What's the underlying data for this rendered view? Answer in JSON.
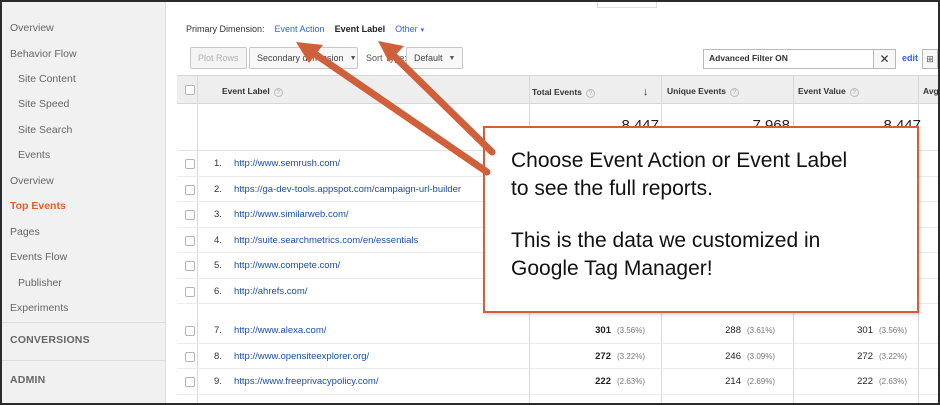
{
  "sidebar": {
    "items": [
      {
        "label": "Overview"
      },
      {
        "label": "Behavior Flow"
      },
      {
        "label": "Site Content"
      },
      {
        "label": "Site Speed"
      },
      {
        "label": "Site Search"
      },
      {
        "label": "Events"
      },
      {
        "label": "Overview"
      },
      {
        "label": "Top Events"
      },
      {
        "label": "Pages"
      },
      {
        "label": "Events Flow"
      },
      {
        "label": "Publisher"
      },
      {
        "label": "Experiments"
      }
    ],
    "sections": {
      "conversions": "CONVERSIONS",
      "admin": "ADMIN"
    }
  },
  "dimensions": {
    "label": "Primary Dimension:",
    "event_action": "Event Action",
    "event_label": "Event Label",
    "other": "Other"
  },
  "toolbar": {
    "plot_rows": "Plot Rows",
    "secondary_dimension": "Secondary dimension",
    "sort_type_label": "Sort Type:",
    "sort_type_value": "Default",
    "filter_value": "Advanced Filter ON",
    "edit": "edit"
  },
  "table": {
    "headers": {
      "event_label": "Event Label",
      "total_events": "Total Events",
      "unique_events": "Unique Events",
      "event_value": "Event Value",
      "avg": "Avg"
    },
    "totals": {
      "total_events": "8,447",
      "unique_events": "7,968",
      "event_value": "8,447"
    },
    "rows": [
      {
        "num": "1.",
        "label": "http://www.semrush.com/"
      },
      {
        "num": "2.",
        "label": "https://ga-dev-tools.appspot.com/campaign-url-builder"
      },
      {
        "num": "3.",
        "label": "http://www.similarweb.com/"
      },
      {
        "num": "4.",
        "label": "http://suite.searchmetrics.com/en/essentials"
      },
      {
        "num": "5.",
        "label": "http://www.compete.com/"
      },
      {
        "num": "6.",
        "label": "http://ahrefs.com/"
      },
      {
        "num": "7.",
        "label": "http://www.alexa.com/",
        "total": "301",
        "total_pct": "(3.56%)",
        "unique": "288",
        "unique_pct": "(3.61%)",
        "value": "301",
        "value_pct": "(3.56%)"
      },
      {
        "num": "8.",
        "label": "http://www.opensiteexplorer.org/",
        "total": "272",
        "total_pct": "(3.22%)",
        "unique": "246",
        "unique_pct": "(3.09%)",
        "value": "272",
        "value_pct": "(3.22%)"
      },
      {
        "num": "9.",
        "label": "https://www.freeprivacypolicy.com/",
        "total": "222",
        "total_pct": "(2.63%)",
        "unique": "214",
        "unique_pct": "(2.69%)",
        "value": "222",
        "value_pct": "(2.63%)"
      }
    ]
  },
  "callout": {
    "line1": "Choose Event Action or Event Label",
    "line2": "to see the full reports.",
    "line3": "This is the data we customized in",
    "line4": "Google Tag Manager!"
  },
  "colors": {
    "accent": "#e35f2a",
    "arrow": "#d0603a",
    "link": "#1a4fa3"
  }
}
